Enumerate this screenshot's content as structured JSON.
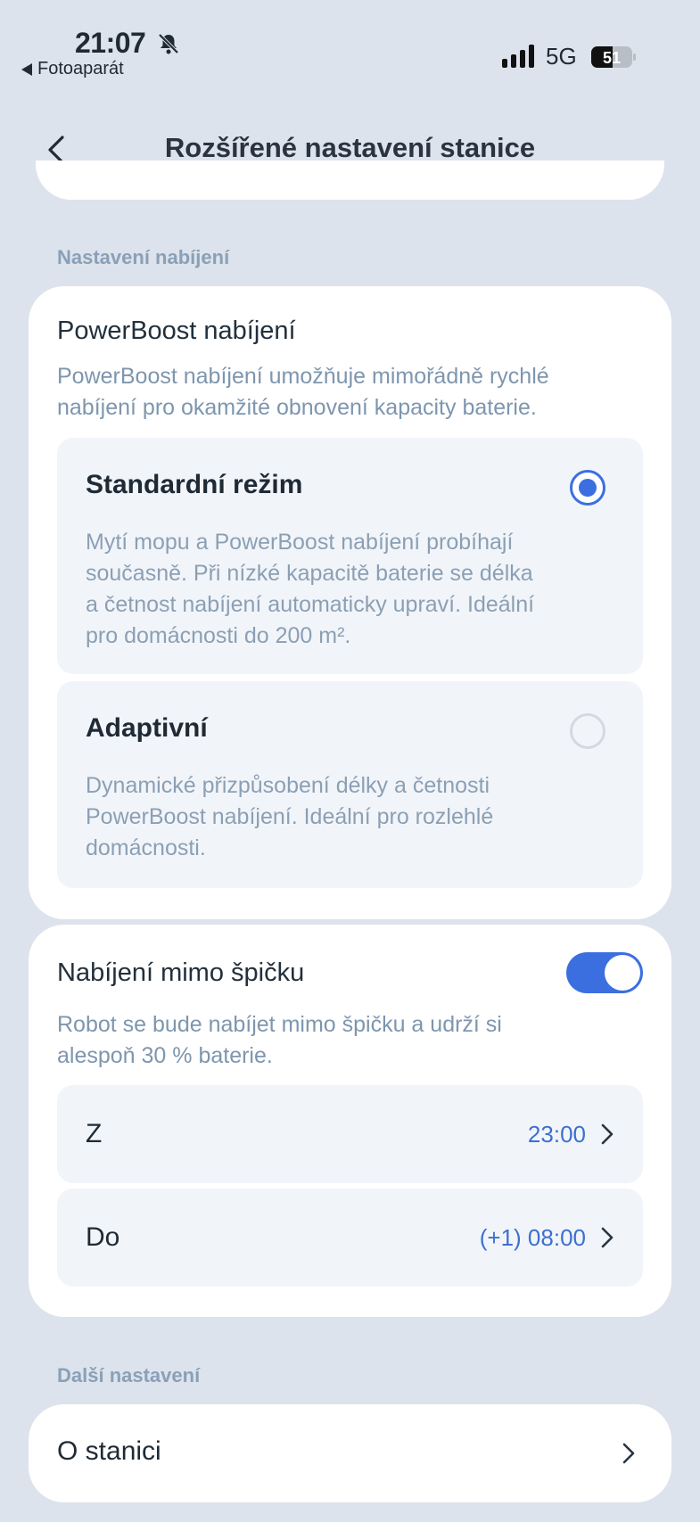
{
  "status_bar": {
    "time": "21:07",
    "back_app": "Fotoaparát",
    "network": "5G",
    "battery": "51"
  },
  "header": {
    "title": "Rozšířené nastavení stanice"
  },
  "charging_section": {
    "title": "Nastavení nabíjení",
    "powerboost": {
      "title": "PowerBoost nabíjení",
      "desc_line1": "PowerBoost nabíjení umožňuje mimořádně rychlé",
      "desc_line2": "nabíjení pro okamžité obnovení kapacity baterie.",
      "options": [
        {
          "title": "Standardní režim",
          "selected": true,
          "desc_lines": [
            "Mytí mopu a PowerBoost nabíjení probíhají",
            "současně. Při nízké kapacitě baterie se délka",
            "a četnost nabíjení automaticky upraví. Ideální",
            "pro domácnosti do 200 m²."
          ]
        },
        {
          "title": "Adaptivní",
          "selected": false,
          "desc_lines": [
            "Dynamické přizpůsobení délky a četnosti",
            "PowerBoost nabíjení. Ideální pro rozlehlé",
            "domácnosti."
          ]
        }
      ]
    },
    "offpeak": {
      "title": "Nabíjení mimo špičku",
      "enabled": true,
      "desc_line1": "Robot se bude nabíjet mimo špičku a udrží si",
      "desc_line2": "alespoň 30 % baterie.",
      "from_label": "Z",
      "from_value": "23:00",
      "to_label": "Do",
      "to_value": "(+1) 08:00"
    }
  },
  "more_section": {
    "title": "Další nastavení",
    "about_label": "O stanici"
  },
  "colors": {
    "accent": "#3b6fe0",
    "background": "#dde3ec",
    "card": "#ffffff",
    "option_bg": "#f1f5fa"
  }
}
